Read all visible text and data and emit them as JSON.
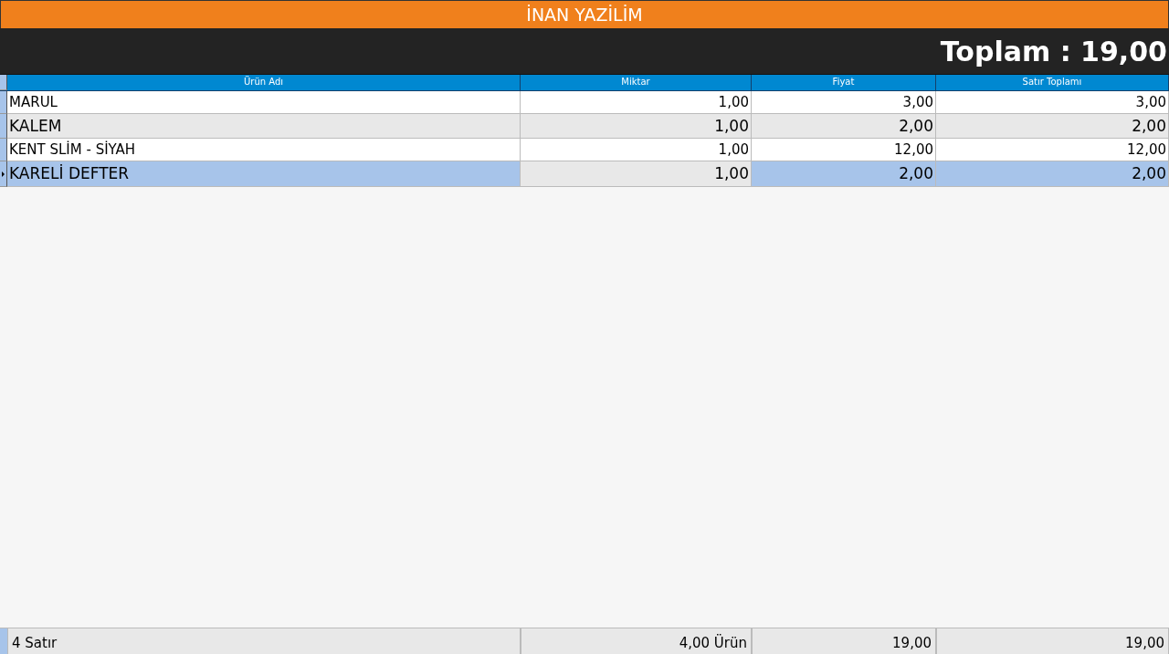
{
  "title": "İNAN YAZİLİM",
  "total": "Toplam : 19,00",
  "table": {
    "columns": [
      "Ürün Adı",
      "Miktar",
      "Fiyat",
      "Satır Toplamı"
    ],
    "rows": [
      {
        "selected": false,
        "cells": [
          {
            "text": "MARUL",
            "focused": false
          },
          {
            "text": "1,00",
            "focused": false
          },
          {
            "text": "3,00",
            "focused": false
          },
          {
            "text": "3,00",
            "focused": false
          }
        ]
      },
      {
        "selected": false,
        "cells": [
          {
            "text": "KALEM",
            "focused": false
          },
          {
            "text": "1,00",
            "focused": false
          },
          {
            "text": "2,00",
            "focused": false
          },
          {
            "text": "2,00",
            "focused": false
          }
        ]
      },
      {
        "selected": false,
        "cells": [
          {
            "text": "KENT SLİM - SİYAH",
            "focused": false
          },
          {
            "text": "1,00",
            "focused": false
          },
          {
            "text": "12,00",
            "focused": false
          },
          {
            "text": "12,00",
            "focused": false
          }
        ]
      },
      {
        "selected": true,
        "cells": [
          {
            "text": "KARELİ DEFTER",
            "focused": false
          },
          {
            "text": "1,00",
            "focused": true
          },
          {
            "text": "2,00",
            "focused": false
          },
          {
            "text": "2,00",
            "focused": false
          }
        ]
      }
    ],
    "footer": [
      "4 Satır",
      "4,00 Ürün",
      "19,00",
      "19,00"
    ]
  }
}
